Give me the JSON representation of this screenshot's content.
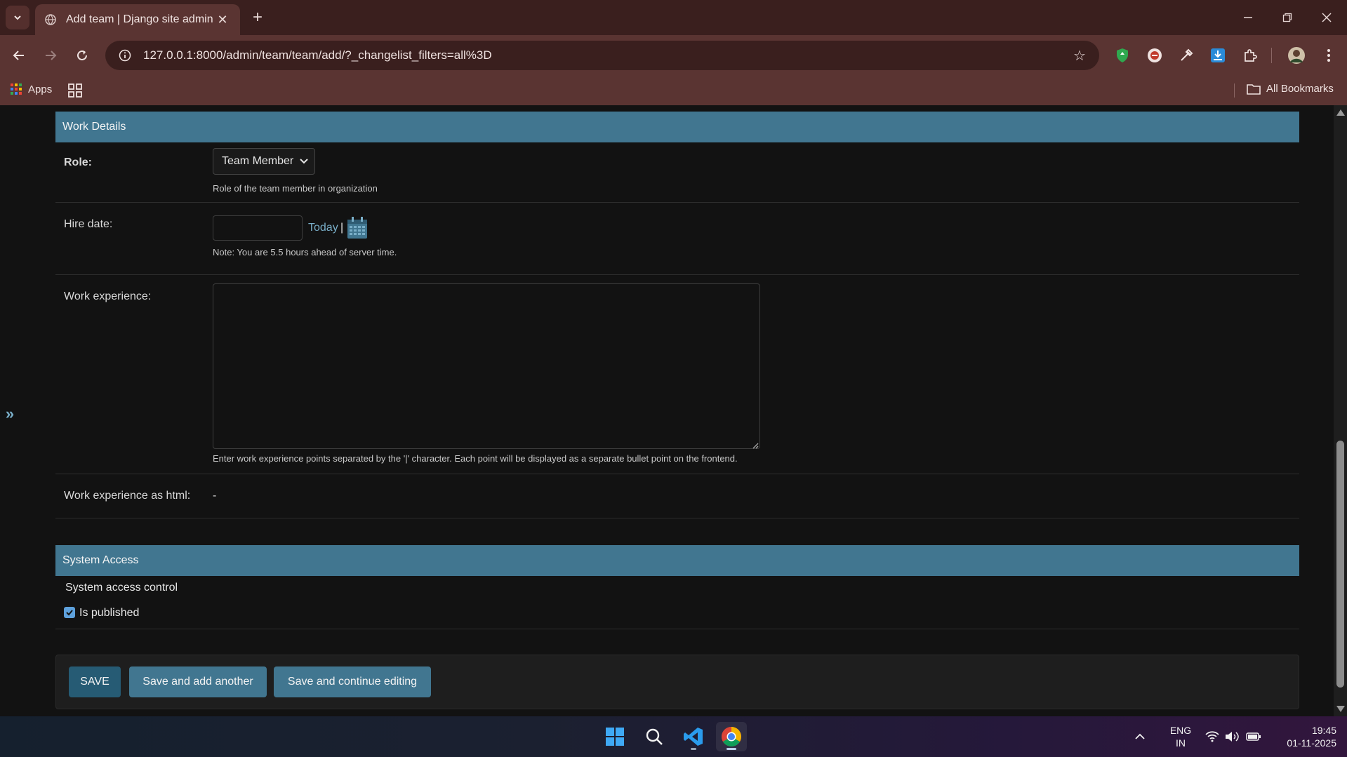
{
  "browser": {
    "tab_title": "Add team | Django site admin",
    "url": "127.0.0.1:8000/admin/team/team/add/?_changelist_filters=all%3D",
    "bookmarks": {
      "apps_label": "Apps",
      "all_bookmarks_label": "All Bookmarks"
    }
  },
  "work_details": {
    "header": "Work Details",
    "role": {
      "label": "Role:",
      "selected": "Team Member",
      "help": "Role of the team member in organization"
    },
    "hire_date": {
      "label": "Hire date:",
      "value": "",
      "today_link": "Today",
      "separator": "|",
      "note": "Note: You are 5.5 hours ahead of server time."
    },
    "work_experience": {
      "label": "Work experience:",
      "value": "",
      "help": "Enter work experience points separated by the '|' character. Each point will be displayed as a separate bullet point on the frontend."
    },
    "work_experience_html": {
      "label": "Work experience as html:",
      "value": "-"
    }
  },
  "system_access": {
    "header": "System Access",
    "description": "System access control",
    "is_published": {
      "label": "Is published",
      "checked": true
    }
  },
  "submit": {
    "save": "SAVE",
    "save_add_another": "Save and add another",
    "save_continue": "Save and continue editing"
  },
  "taskbar": {
    "language_line1": "ENG",
    "language_line2": "IN",
    "time": "19:45",
    "date": "01-11-2025"
  },
  "colors": {
    "module_header": "#417690",
    "link": "#79aec8",
    "save_button": "#265b74",
    "secondary_button": "#417690",
    "page_bg": "#121212",
    "chrome_frame": "#5a3432"
  }
}
